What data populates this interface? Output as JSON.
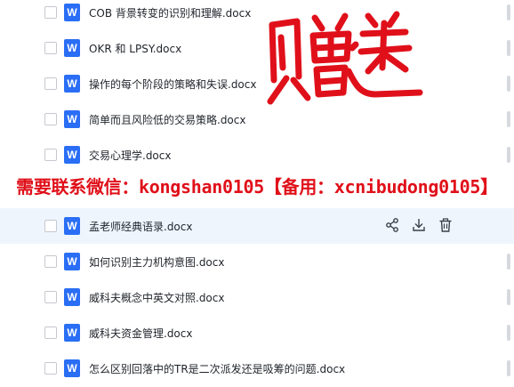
{
  "files": [
    {
      "name": "COB 背景转变的识别和理解.docx",
      "icon": "word-doc-icon",
      "icon_letter": "W"
    },
    {
      "name": "OKR 和 LPSY.docx",
      "icon": "word-doc-icon",
      "icon_letter": "W"
    },
    {
      "name": "操作的每个阶段的策略和失误.docx",
      "icon": "word-doc-icon",
      "icon_letter": "W"
    },
    {
      "name": "简单而且风险低的交易策略.docx",
      "icon": "word-doc-icon",
      "icon_letter": "W"
    },
    {
      "name": "交易心理学.docx",
      "icon": "word-doc-icon",
      "icon_letter": "W"
    },
    {
      "name": "孟老师经典语录.docx",
      "icon": "word-doc-icon",
      "icon_letter": "W"
    },
    {
      "name": "如何识别主力机构意图.docx",
      "icon": "word-doc-icon",
      "icon_letter": "W"
    },
    {
      "name": "威科夫概念中英文对照.docx",
      "icon": "word-doc-icon",
      "icon_letter": "W"
    },
    {
      "name": "威科夫资金管理.docx",
      "icon": "word-doc-icon",
      "icon_letter": "W"
    },
    {
      "name": "怎么区别回落中的TR是二次派发还是吸筹的问题.docx",
      "icon": "word-doc-icon",
      "icon_letter": "W"
    }
  ],
  "row_actions": {
    "share": "share-icon",
    "download": "download-icon",
    "delete": "trash-icon"
  },
  "overlay": {
    "stamp_text": "赠送",
    "banner_text": "需要联系微信：kongshan0105【备用：xcnibudong0105】"
  },
  "colors": {
    "word_icon": "#2a6ef5",
    "hover_row": "#eef5fd",
    "overlay_red": "#e0101a"
  }
}
